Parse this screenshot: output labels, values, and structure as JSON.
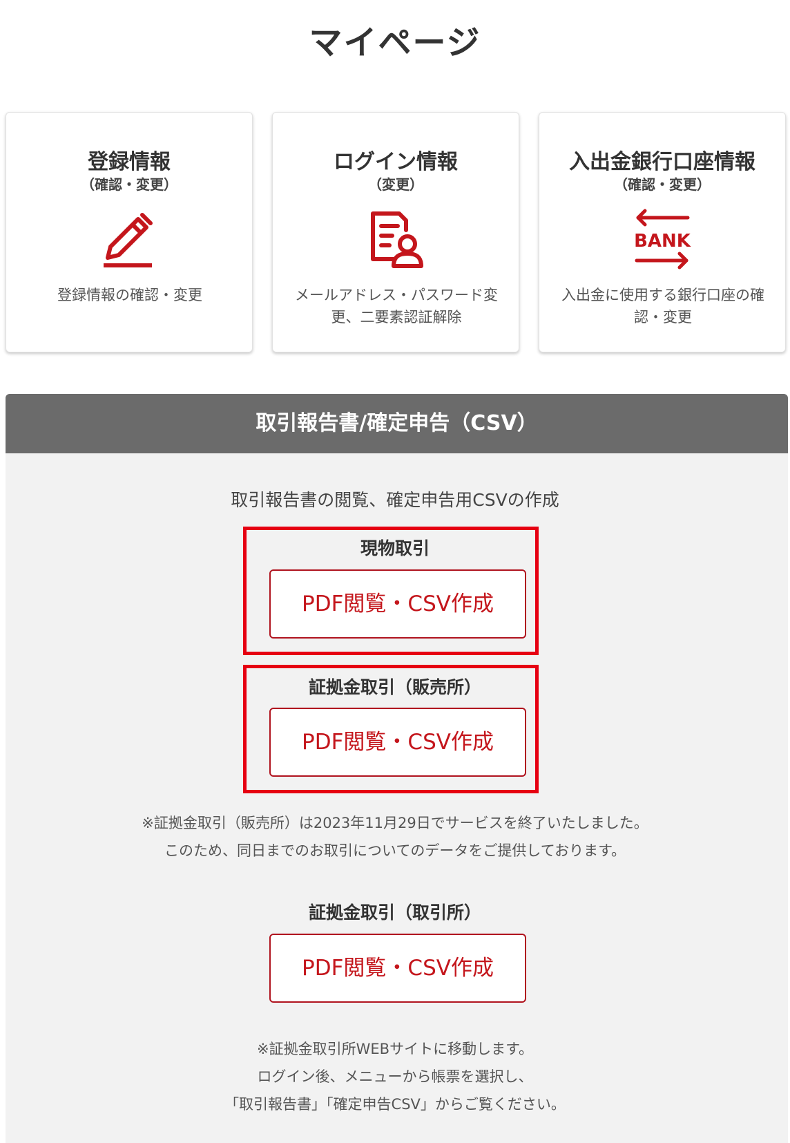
{
  "page": {
    "title": "マイページ"
  },
  "cards": [
    {
      "title": "登録情報",
      "sub": "（確認・変更）",
      "icon": "pencil-icon",
      "desc": "登録情報の確認・変更"
    },
    {
      "title": "ログイン情報",
      "sub": "（変更）",
      "icon": "document-user-icon",
      "desc": "メールアドレス・パスワード変更、二要素認証解除"
    },
    {
      "title": "入出金銀行口座情報",
      "sub": "（確認・変更）",
      "icon": "bank-transfer-icon",
      "icon_text": "BANK",
      "desc": "入出金に使用する銀行口座の確認・変更"
    }
  ],
  "section": {
    "title": "取引報告書/確定申告（CSV）",
    "intro": "取引報告書の閲覧、確定申告用CSVの作成",
    "groups": [
      {
        "label": "現物取引",
        "button": "PDF閲覧・CSV作成"
      },
      {
        "label": "証拠金取引（販売所）",
        "button": "PDF閲覧・CSV作成"
      },
      {
        "label": "証拠金取引（取引所）",
        "button": "PDF閲覧・CSV作成"
      }
    ],
    "note1": [
      "※証拠金取引（販売所）は2023年11月29日でサービスを終了いたしました。",
      "このため、同日までのお取引についてのデータをご提供しております。"
    ],
    "note2": [
      "※証拠金取引所WEBサイトに移動します。",
      "ログイン後、メニューから帳票を選択し、",
      "「取引報告書」「確定申告CSV」からご覧ください。"
    ]
  },
  "colors": {
    "accent": "#c4161c",
    "highlight": "#e60012",
    "header_bg": "#6b6b6b",
    "section_bg": "#f2f2f2"
  }
}
